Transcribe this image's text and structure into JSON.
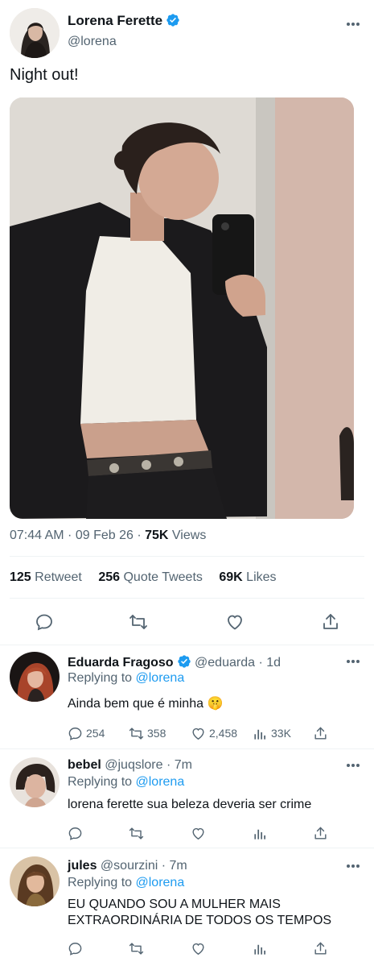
{
  "tweet": {
    "author_name": "Lorena Ferette",
    "author_handle": "@lorena",
    "text": "Night out!",
    "time": "07:44 AM",
    "date": "09 Feb 26",
    "views_count": "75K",
    "views_label": "Views",
    "retweets_count": "125",
    "retweets_label": "Retweet",
    "quotes_count": "256",
    "quotes_label": "Quote Tweets",
    "likes_count": "69K",
    "likes_label": "Likes"
  },
  "replies": [
    {
      "name": "Eduarda Fragoso",
      "verified": true,
      "handle": "@eduarda",
      "time": "1d",
      "replying_prefix": "Replying to",
      "replying_to": "@lorena",
      "text": "Ainda bem que é minha 🤫",
      "reply_count": "254",
      "retweet_count": "358",
      "like_count": "2,458",
      "view_count": "33K"
    },
    {
      "name": "bebel",
      "verified": false,
      "handle": "@juqslore",
      "time": "7m",
      "replying_prefix": "Replying to",
      "replying_to": "@lorena",
      "text": "lorena ferette sua beleza deveria ser crime",
      "reply_count": "",
      "retweet_count": "",
      "like_count": "",
      "view_count": ""
    },
    {
      "name": "jules",
      "verified": false,
      "handle": "@sourzini",
      "time": "7m",
      "replying_prefix": "Replying to",
      "replying_to": "@lorena",
      "text": "EU QUANDO SOU A MULHER MAIS EXTRAORDINÁRIA DE TODOS OS TEMPOS",
      "reply_count": "",
      "retweet_count": "",
      "like_count": "",
      "view_count": ""
    }
  ],
  "colors": {
    "accent": "#1d9bf0",
    "text_primary": "#0f1419",
    "text_secondary": "#536471",
    "divider": "#eff3f4"
  },
  "icons": [
    "verified-badge-icon",
    "more-icon",
    "reply-icon",
    "retweet-icon",
    "like-icon",
    "share-icon",
    "views-icon"
  ]
}
